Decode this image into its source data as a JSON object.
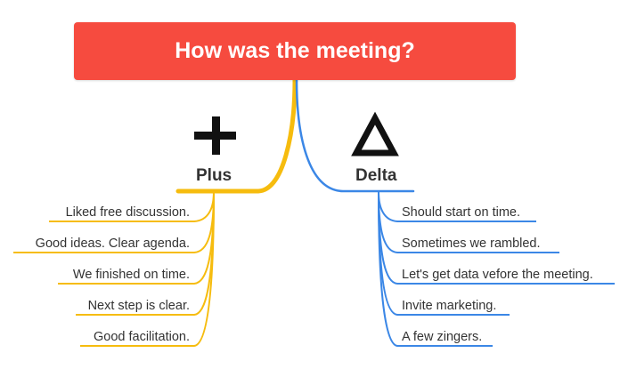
{
  "root": {
    "title": "How was the meeting?",
    "color": "#f64b3f"
  },
  "branches": [
    {
      "id": "plus",
      "label": "Plus",
      "icon": "plus-icon",
      "color": "#f6bc0e",
      "items": [
        "Liked free discussion.",
        "Good ideas. Clear agenda.",
        "We finished on time.",
        "Next step is clear.",
        "Good facilitation."
      ]
    },
    {
      "id": "delta",
      "label": "Delta",
      "icon": "delta-triangle-icon",
      "color": "#3b87e6",
      "items": [
        "Should start on time.",
        "Sometimes we rambled.",
        "Let's get data vefore the meeting.",
        "Invite marketing.",
        "A few zingers."
      ]
    }
  ]
}
